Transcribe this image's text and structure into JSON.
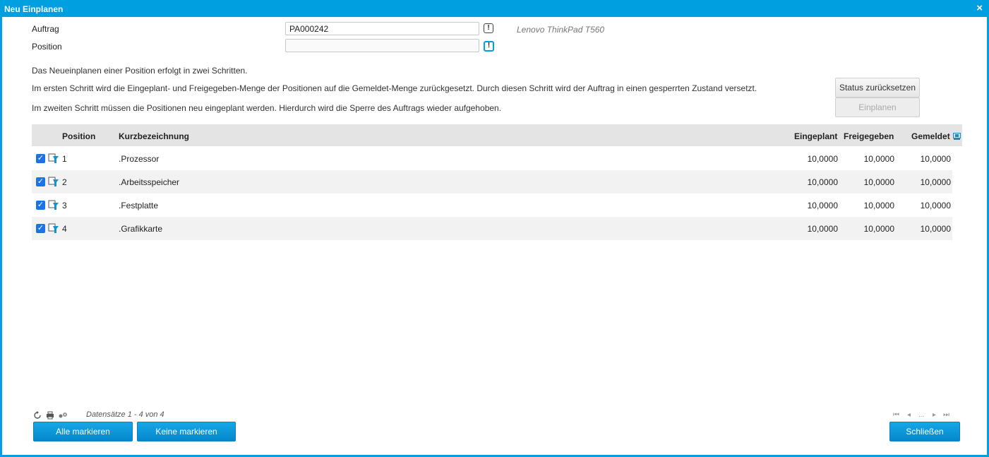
{
  "window": {
    "title": "Neu Einplanen",
    "close_glyph": "×"
  },
  "form": {
    "auftrag_label": "Auftrag",
    "auftrag_value": "PA000242",
    "auftrag_hint": "Lenovo ThinkPad T560",
    "position_label": "Position",
    "position_value": "",
    "required_marker": "!"
  },
  "info": {
    "line1": "Das Neueinplanen einer Position erfolgt in zwei Schritten.",
    "line2": "Im ersten Schritt wird die Eingeplant- und Freigegeben-Menge der Positionen auf die Gemeldet-Menge zurückgesetzt. Durch diesen Schritt wird der Auftrag in einen gesperrten Zustand versetzt.",
    "line3": "Im zweiten Schritt müssen die Positionen neu eingeplant werden. Hierdurch wird die Sperre des Auftrags wieder aufgehoben."
  },
  "actions": {
    "reset_label": "Status zurücksetzen",
    "plan_label": "Einplanen"
  },
  "table": {
    "columns": {
      "position": "Position",
      "kurz": "Kurzbezeichnung",
      "eingeplant": "Eingeplant",
      "freigegeben": "Freigegeben",
      "gemeldet": "Gemeldet"
    },
    "rows": [
      {
        "checked": true,
        "position": "1",
        "kurz": ".Prozessor",
        "eingeplant": "10,0000",
        "freigegeben": "10,0000",
        "gemeldet": "10,0000"
      },
      {
        "checked": true,
        "position": "2",
        "kurz": ".Arbeitsspeicher",
        "eingeplant": "10,0000",
        "freigegeben": "10,0000",
        "gemeldet": "10,0000"
      },
      {
        "checked": true,
        "position": "3",
        "kurz": ".Festplatte",
        "eingeplant": "10,0000",
        "freigegeben": "10,0000",
        "gemeldet": "10,0000"
      },
      {
        "checked": true,
        "position": "4",
        "kurz": ".Grafikkarte",
        "eingeplant": "10,0000",
        "freigegeben": "10,0000",
        "gemeldet": "10,0000"
      }
    ]
  },
  "footer": {
    "records": "Datensätze 1 - 4 von 4",
    "pager_ellipsis": "...",
    "select_all": "Alle markieren",
    "select_none": "Keine markieren",
    "close": "Schließen"
  },
  "colors": {
    "accent": "#009fdf",
    "checkbox": "#1a73e8"
  }
}
